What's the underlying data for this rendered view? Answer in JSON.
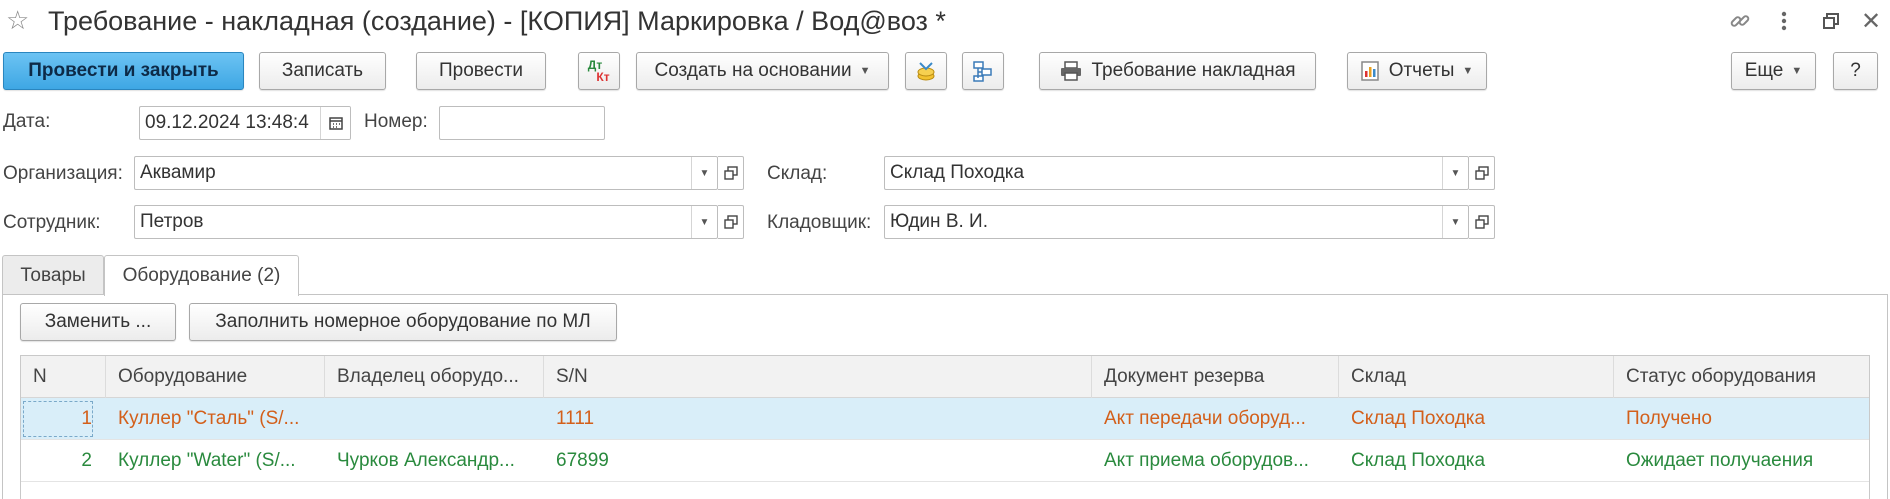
{
  "window": {
    "title": "Требование - накладная (создание) - [КОПИЯ] Маркировка / Вод@воз *"
  },
  "toolbar": {
    "post_close": "Провести и закрыть",
    "save": "Записать",
    "post": "Провести",
    "dt_label": "Дт",
    "kt_label": "Кт",
    "create_based": "Создать на основании",
    "print_doc": "Требование накладная",
    "reports": "Отчеты",
    "more": "Еще",
    "help": "?"
  },
  "form": {
    "date_label": "Дата:",
    "date_value": "09.12.2024 13:48:4",
    "number_label": "Номер:",
    "number_value": "",
    "org_label": "Организация:",
    "org_value": "Аквамир",
    "warehouse_label": "Склад:",
    "warehouse_value": "Склад Походка",
    "employee_label": "Сотрудник:",
    "employee_value": "Петров",
    "storekeeper_label": "Кладовщик:",
    "storekeeper_value": "Юдин В. И."
  },
  "tabs": [
    {
      "label": "Товары",
      "active": false
    },
    {
      "label": "Оборудование (2)",
      "active": true
    }
  ],
  "panel": {
    "replace": "Заменить ...",
    "fill": "Заполнить номерное оборудование по МЛ"
  },
  "table": {
    "columns": [
      "N",
      "Оборудование",
      "Владелец оборудо...",
      "S/N",
      "Документ резерва",
      "Склад",
      "Статус оборудования"
    ],
    "rows": [
      {
        "n": "1",
        "equipment": "Куллер \"Сталь\" (S/...",
        "owner": "",
        "sn": "1111",
        "doc": "Акт передачи оборуд...",
        "warehouse": "Склад Походка",
        "status": "Получено",
        "color": "#d35f1a",
        "selected": true
      },
      {
        "n": "2",
        "equipment": "Куллер \"Water\" (S/...",
        "owner": "Чурков Александр...",
        "sn": "67899",
        "doc": "Акт приема оборудов...",
        "warehouse": "Склад Походка",
        "status": "Ожидает получаения",
        "color": "#2a8a3e",
        "selected": false
      }
    ]
  },
  "colors": {
    "primary_button": "#3ea7e4",
    "selected_row": "#d9eef9",
    "orange_text": "#d35f1a",
    "green_text": "#2a8a3e"
  }
}
